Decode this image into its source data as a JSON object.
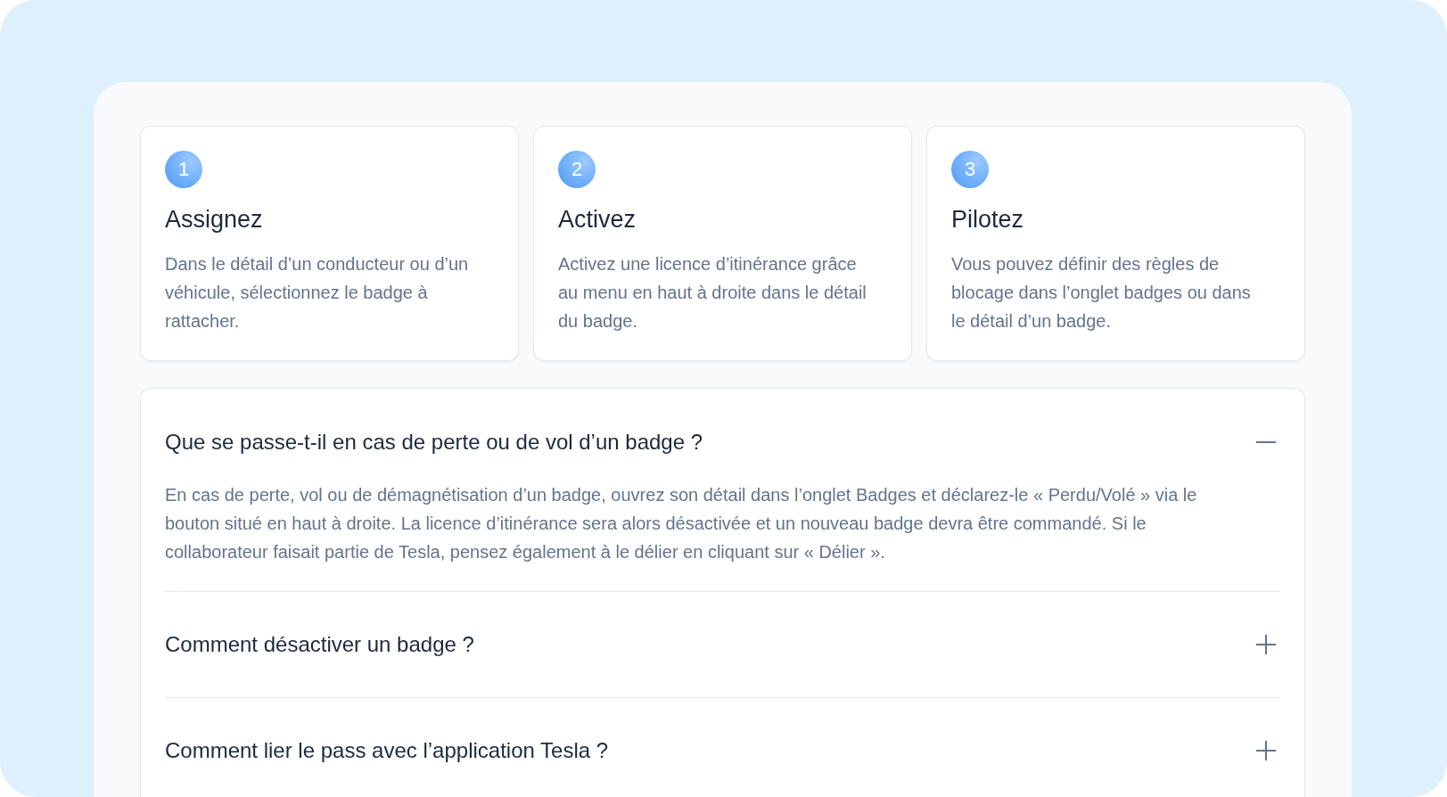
{
  "steps": [
    {
      "number": "1",
      "title": "Assignez",
      "text": "Dans le détail d’un conducteur ou d’un véhicule, sélectionnez le badge à rattacher."
    },
    {
      "number": "2",
      "title": "Activez",
      "text": "Activez une licence d’itinérance grâce au menu en haut à droite dans le détail du badge."
    },
    {
      "number": "3",
      "title": "Pilotez",
      "text": "Vous pouvez définir des règles de blocage dans l’onglet badges ou dans le détail d’un badge."
    }
  ],
  "faq": [
    {
      "question": "Que se passe-t-il en cas de perte ou de vol d’un badge ?",
      "expanded": true,
      "answer": "En cas de perte, vol ou de démagnétisation d’un badge, ouvrez son détail dans l’onglet Badges et déclarez-le « Perdu/Volé » via le bouton situé en haut à droite. La licence d’itinérance sera alors désactivée et un nouveau badge devra être commandé. Si le collaborateur faisait partie de Tesla, pensez également à le délier en cliquant sur « Délier »."
    },
    {
      "question": "Comment désactiver un badge ?",
      "expanded": false
    },
    {
      "question": "Comment lier le pass avec l’application Tesla ?",
      "expanded": false
    }
  ]
}
